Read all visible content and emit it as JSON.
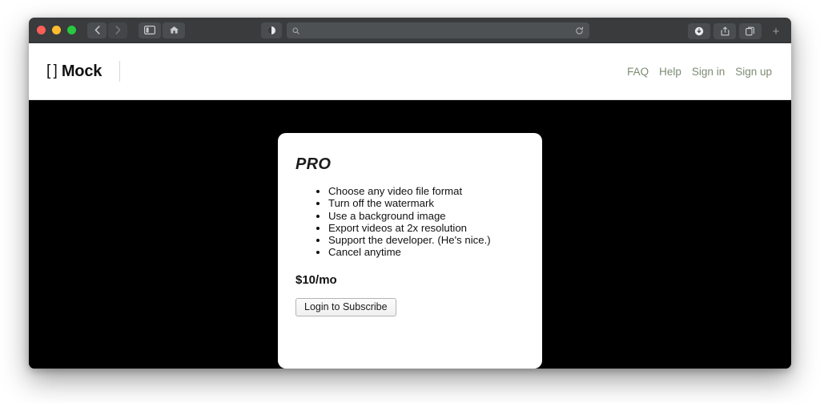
{
  "browser": {
    "traffic_lights": {
      "close_color": "#ff5f57",
      "minimize_color": "#febc2e",
      "maximize_color": "#28c840"
    },
    "toolbar_color": "#393b3d",
    "address_bar": {
      "value": "",
      "placeholder": ""
    },
    "icons": {
      "back": "back-chevron-icon",
      "forward": "forward-chevron-icon",
      "sidebar": "sidebar-toggle-icon",
      "home": "home-icon",
      "reader": "reader-contrast-icon",
      "search": "search-icon",
      "reload": "reload-icon",
      "downloads": "download-icon",
      "share": "share-icon",
      "tabs": "tab-overview-icon",
      "new_tab": "+"
    }
  },
  "site": {
    "brand": {
      "brackets": "[ ]",
      "name": "Mock"
    },
    "nav": [
      {
        "label": "FAQ"
      },
      {
        "label": "Help"
      },
      {
        "label": "Sign in"
      },
      {
        "label": "Sign up"
      }
    ],
    "nav_color": "#7c8c74",
    "hero_background": "#000000"
  },
  "card": {
    "title": "PRO",
    "features": [
      "Choose any video file format",
      "Turn off the watermark",
      "Use a background image",
      "Export videos at 2x resolution",
      "Support the developer. (He's nice.)",
      "Cancel anytime"
    ],
    "price": "$10/mo",
    "cta_label": "Login to Subscribe"
  }
}
